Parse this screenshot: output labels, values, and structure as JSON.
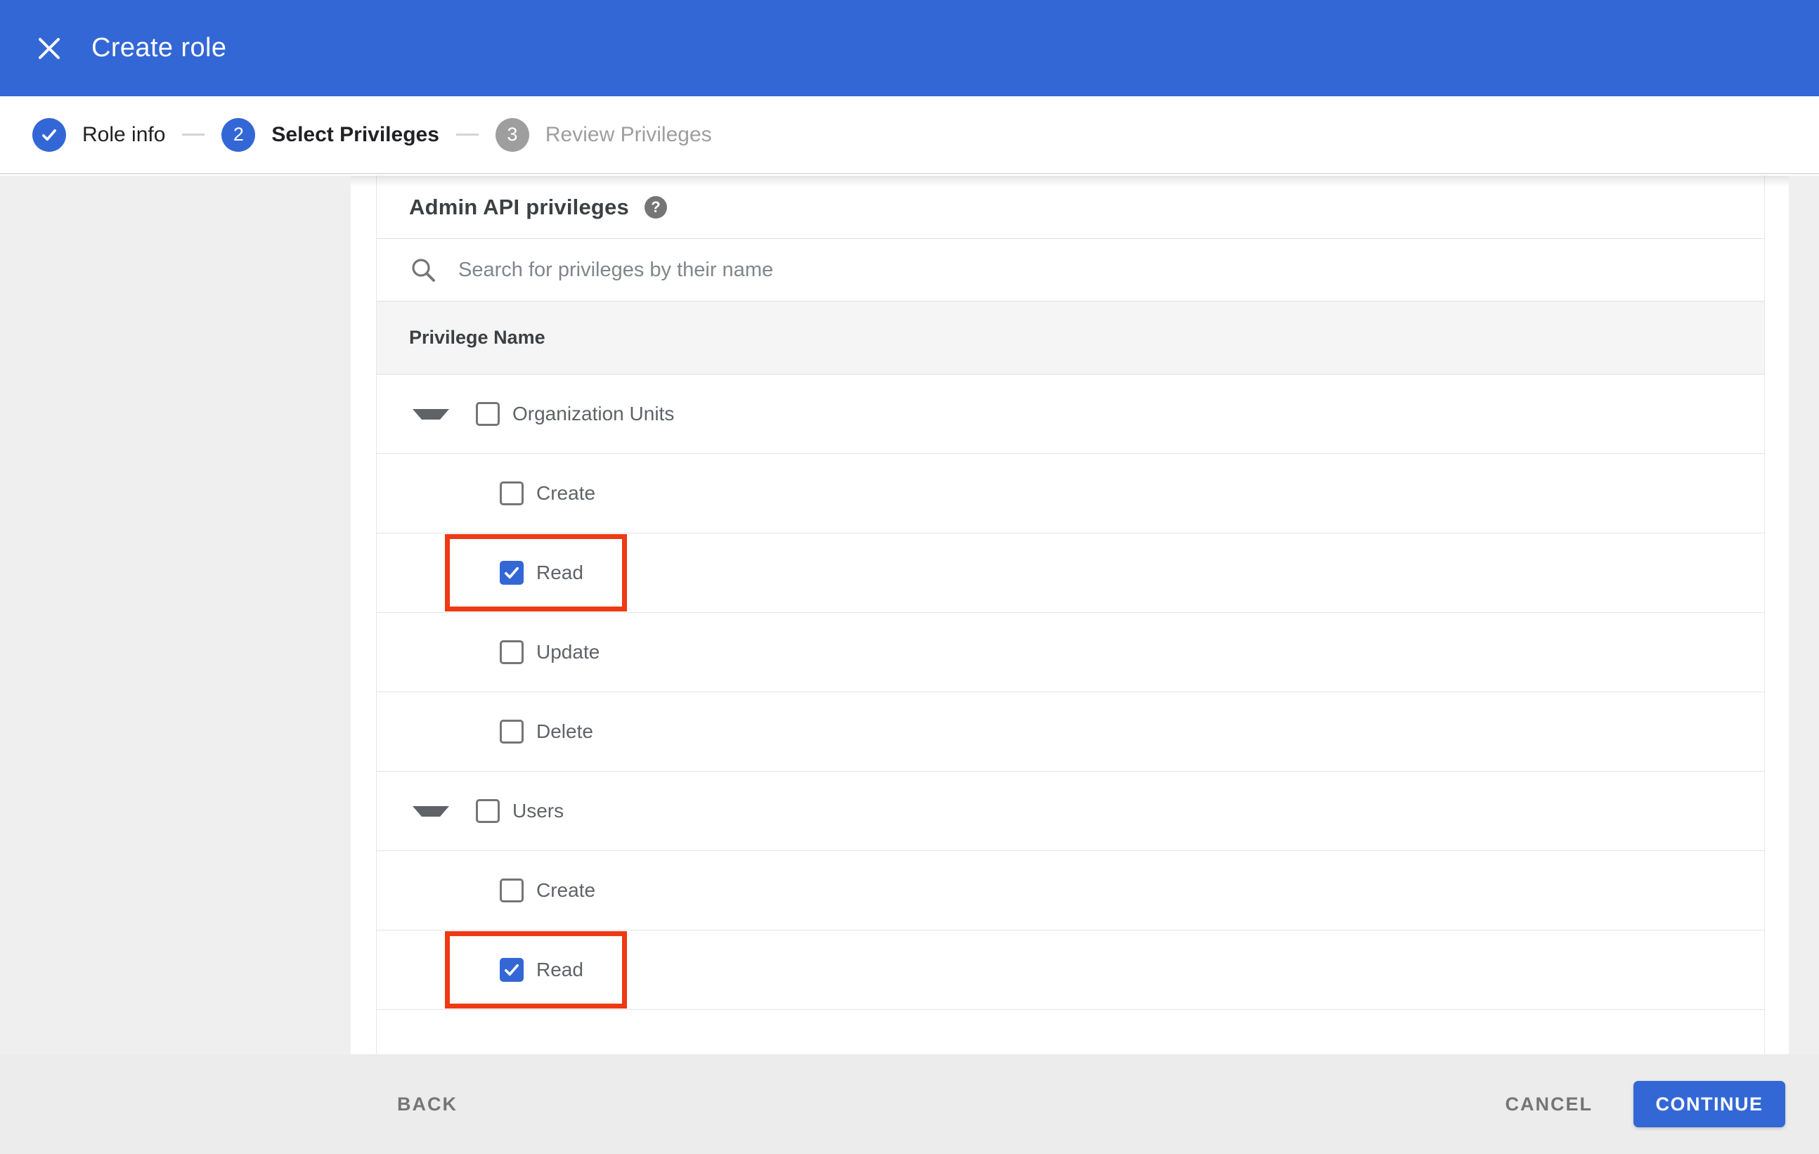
{
  "header": {
    "title": "Create role"
  },
  "stepper": {
    "steps": [
      {
        "label": "Role info",
        "state": "complete",
        "number": ""
      },
      {
        "label": "Select Privileges",
        "state": "active",
        "number": "2"
      },
      {
        "label": "Review Privileges",
        "state": "upcoming",
        "number": "3"
      }
    ]
  },
  "panel": {
    "heading": "Admin API privileges",
    "help_glyph": "?",
    "search": {
      "placeholder": "Search for privileges by their name",
      "value": ""
    },
    "table": {
      "header": "Privilege Name",
      "rows": [
        {
          "type": "group",
          "label": "Organization Units",
          "checked": false,
          "expanded": true,
          "highlighted": false
        },
        {
          "type": "child",
          "label": "Create",
          "checked": false,
          "highlighted": false
        },
        {
          "type": "child",
          "label": "Read",
          "checked": true,
          "highlighted": true
        },
        {
          "type": "child",
          "label": "Update",
          "checked": false,
          "highlighted": false
        },
        {
          "type": "child",
          "label": "Delete",
          "checked": false,
          "highlighted": false
        },
        {
          "type": "group",
          "label": "Users",
          "checked": false,
          "expanded": true,
          "highlighted": false
        },
        {
          "type": "child",
          "label": "Create",
          "checked": false,
          "highlighted": false
        },
        {
          "type": "child",
          "label": "Read",
          "checked": true,
          "highlighted": true
        }
      ]
    }
  },
  "footer": {
    "back_label": "BACK",
    "cancel_label": "CANCEL",
    "continue_label": "CONTINUE"
  },
  "colors": {
    "accent_blue": "#3367d6",
    "annotation_red": "#ee3a14",
    "upcoming_gray": "#9e9e9e",
    "side_pane_gray": "#efefef",
    "footer_gray": "#ececec",
    "table_header_gray": "#f5f5f5"
  }
}
